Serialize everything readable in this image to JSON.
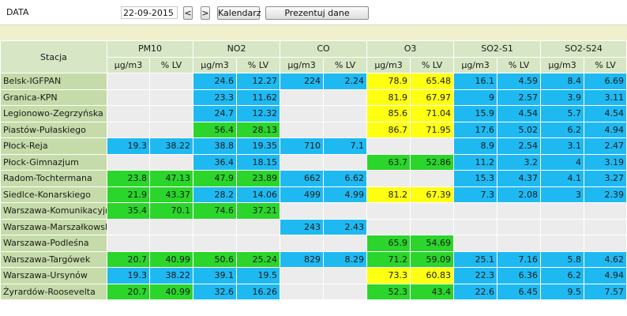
{
  "toolbar": {
    "date_label": "DATA",
    "date_value": "22-09-2015",
    "prev_label": "<",
    "next_label": ">",
    "calendar_label": "Kalendarz",
    "present_label": "Prezentuj dane"
  },
  "colors": {
    "gray": "#ececec",
    "blue": "#1fb9f2",
    "green": "#2bd52b",
    "yellow": "#ffff11",
    "header": "#d7e6c4",
    "station": "#c5dba9",
    "spacer": "#f1f0cd"
  },
  "table": {
    "station_header": "Stacja",
    "pollutants": [
      {
        "name": "PM10",
        "unit": "µg/m3",
        "pct": "% LV"
      },
      {
        "name": "NO2",
        "unit": "µg/m3",
        "pct": "% LV"
      },
      {
        "name": "CO",
        "unit": "µg/m3",
        "pct": "% LV"
      },
      {
        "name": "O3",
        "unit": "µg/m3",
        "pct": "% LV"
      },
      {
        "name": "SO2-S1",
        "unit": "µg/m3",
        "pct": "% LV"
      },
      {
        "name": "SO2-S24",
        "unit": "µg/m3",
        "pct": "% LV"
      }
    ],
    "rows": [
      {
        "station": "Belsk-IGFPAN",
        "cells": [
          [
            "",
            "",
            "gray"
          ],
          [
            "24.6",
            "12.27",
            "blue"
          ],
          [
            "224",
            "2.24",
            "blue"
          ],
          [
            "78.9",
            "65.48",
            "yellow"
          ],
          [
            "16.1",
            "4.59",
            "blue"
          ],
          [
            "8.4",
            "6.69",
            "blue"
          ]
        ]
      },
      {
        "station": "Granica-KPN",
        "cells": [
          [
            "",
            "",
            "gray"
          ],
          [
            "23.3",
            "11.62",
            "blue"
          ],
          [
            "",
            "",
            "gray"
          ],
          [
            "81.9",
            "67.97",
            "yellow"
          ],
          [
            "9",
            "2.57",
            "blue"
          ],
          [
            "3.9",
            "3.11",
            "blue"
          ]
        ]
      },
      {
        "station": "Legionowo-Zegrzyńska",
        "cells": [
          [
            "",
            "",
            "gray"
          ],
          [
            "24.7",
            "12.32",
            "blue"
          ],
          [
            "",
            "",
            "gray"
          ],
          [
            "85.6",
            "71.04",
            "yellow"
          ],
          [
            "15.9",
            "4.54",
            "blue"
          ],
          [
            "5.7",
            "4.54",
            "blue"
          ]
        ]
      },
      {
        "station": "Piastów-Pułaskiego",
        "cells": [
          [
            "",
            "",
            "gray"
          ],
          [
            "56.4",
            "28.13",
            "green"
          ],
          [
            "",
            "",
            "gray"
          ],
          [
            "86.7",
            "71.95",
            "yellow"
          ],
          [
            "17.6",
            "5.02",
            "blue"
          ],
          [
            "6.2",
            "4.94",
            "blue"
          ]
        ]
      },
      {
        "station": "Płock-Reja",
        "cells": [
          [
            "19.3",
            "38.22",
            "blue"
          ],
          [
            "38.8",
            "19.35",
            "blue"
          ],
          [
            "710",
            "7.1",
            "blue"
          ],
          [
            "",
            "",
            "gray"
          ],
          [
            "8.9",
            "2.54",
            "blue"
          ],
          [
            "3.1",
            "2.47",
            "blue"
          ]
        ]
      },
      {
        "station": "Płock-Gimnazjum",
        "cells": [
          [
            "",
            "",
            "gray"
          ],
          [
            "36.4",
            "18.15",
            "blue"
          ],
          [
            "",
            "",
            "gray"
          ],
          [
            "63.7",
            "52.86",
            "green"
          ],
          [
            "11.2",
            "3.2",
            "blue"
          ],
          [
            "4",
            "3.19",
            "blue"
          ]
        ]
      },
      {
        "station": "Radom-Tochtermana",
        "cells": [
          [
            "23.8",
            "47.13",
            "green"
          ],
          [
            "47.9",
            "23.89",
            "green"
          ],
          [
            "662",
            "6.62",
            "blue"
          ],
          [
            "",
            "",
            "gray"
          ],
          [
            "15.3",
            "4.37",
            "blue"
          ],
          [
            "4.1",
            "3.27",
            "blue"
          ]
        ]
      },
      {
        "station": "Siedlce-Konarskiego",
        "cells": [
          [
            "21.9",
            "43.37",
            "green"
          ],
          [
            "28.2",
            "14.06",
            "blue"
          ],
          [
            "499",
            "4.99",
            "blue"
          ],
          [
            "81.2",
            "67.39",
            "yellow"
          ],
          [
            "7.3",
            "2.08",
            "blue"
          ],
          [
            "3",
            "2.39",
            "blue"
          ]
        ]
      },
      {
        "station": "Warszawa-Komunikacyjna",
        "cells": [
          [
            "35.4",
            "70.1",
            "green"
          ],
          [
            "74.6",
            "37.21",
            "green"
          ],
          [
            "",
            "",
            "gray"
          ],
          [
            "",
            "",
            "gray"
          ],
          [
            "",
            "",
            "gray"
          ],
          [
            "",
            "",
            "gray"
          ]
        ]
      },
      {
        "station": "Warszawa-Marszałkowska",
        "cells": [
          [
            "",
            "",
            "gray"
          ],
          [
            "",
            "",
            "gray"
          ],
          [
            "243",
            "2.43",
            "blue"
          ],
          [
            "",
            "",
            "gray"
          ],
          [
            "",
            "",
            "gray"
          ],
          [
            "",
            "",
            "gray"
          ]
        ]
      },
      {
        "station": "Warszawa-Podleśna",
        "cells": [
          [
            "",
            "",
            "gray"
          ],
          [
            "",
            "",
            "gray"
          ],
          [
            "",
            "",
            "gray"
          ],
          [
            "65.9",
            "54.69",
            "green"
          ],
          [
            "",
            "",
            "gray"
          ],
          [
            "",
            "",
            "gray"
          ]
        ]
      },
      {
        "station": "Warszawa-Targówek",
        "cells": [
          [
            "20.7",
            "40.99",
            "green"
          ],
          [
            "50.6",
            "25.24",
            "green"
          ],
          [
            "829",
            "8.29",
            "blue"
          ],
          [
            "71.2",
            "59.09",
            "green"
          ],
          [
            "25.1",
            "7.16",
            "blue"
          ],
          [
            "5.8",
            "4.62",
            "blue"
          ]
        ]
      },
      {
        "station": "Warszawa-Ursynów",
        "cells": [
          [
            "19.3",
            "38.22",
            "blue"
          ],
          [
            "39.1",
            "19.5",
            "blue"
          ],
          [
            "",
            "",
            "gray"
          ],
          [
            "73.3",
            "60.83",
            "yellow"
          ],
          [
            "22.3",
            "6.36",
            "blue"
          ],
          [
            "6.2",
            "4.94",
            "blue"
          ]
        ]
      },
      {
        "station": "Żyrardów-Roosevelta",
        "cells": [
          [
            "20.7",
            "40.99",
            "green"
          ],
          [
            "32.6",
            "16.26",
            "blue"
          ],
          [
            "",
            "",
            "gray"
          ],
          [
            "52.3",
            "43.4",
            "green"
          ],
          [
            "22.6",
            "6.45",
            "blue"
          ],
          [
            "9.5",
            "7.57",
            "blue"
          ]
        ]
      }
    ]
  }
}
